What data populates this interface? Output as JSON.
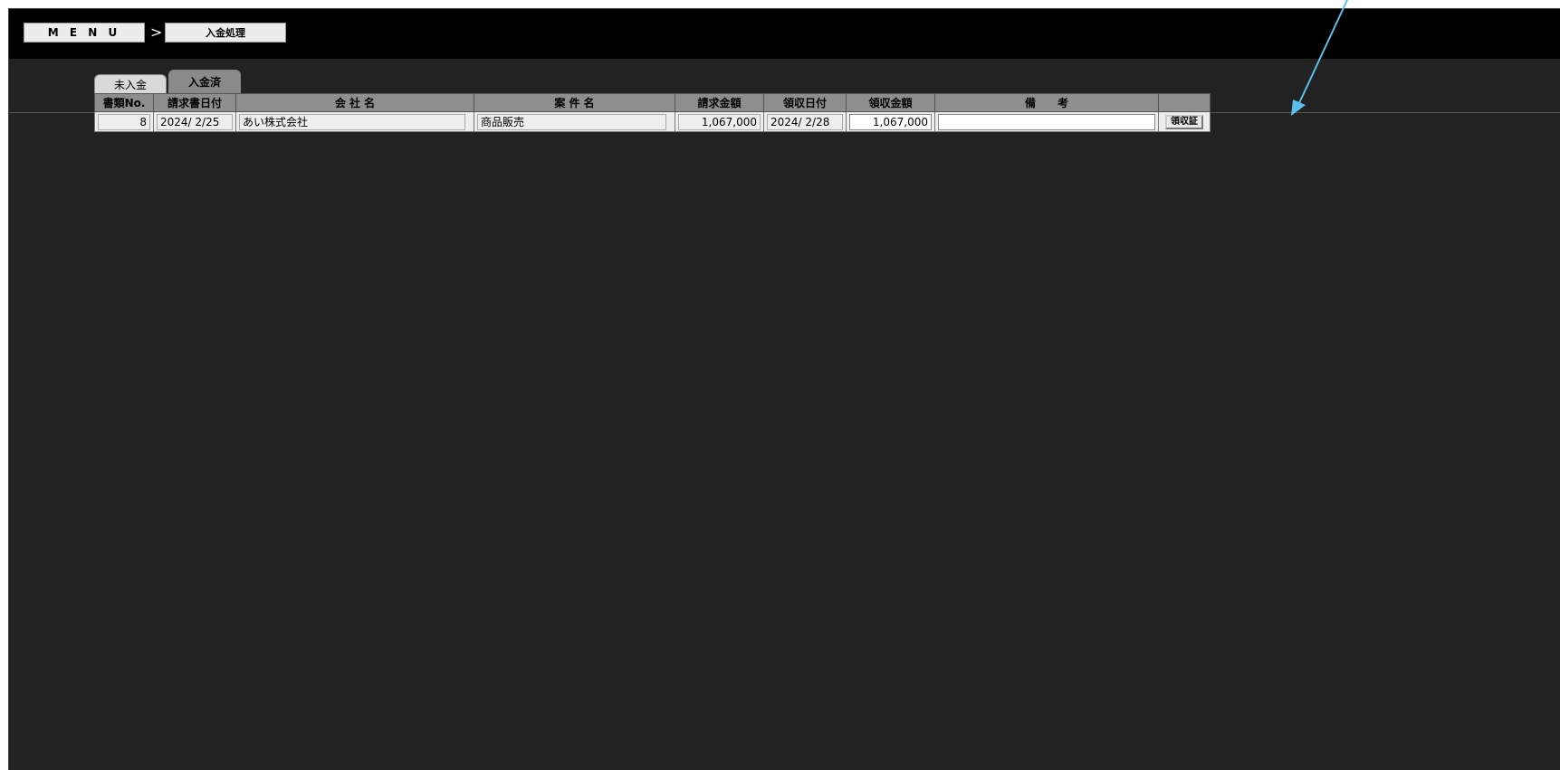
{
  "breadcrumb": {
    "menu_label": "M E N U",
    "separator": ">",
    "current_label": "入金処理"
  },
  "tabs": [
    {
      "label": "未入金",
      "active": false
    },
    {
      "label": "入金済",
      "active": true
    }
  ],
  "table": {
    "headers": [
      "書類No.",
      "請求書日付",
      "会 社 名",
      "案 件 名",
      "請求金額",
      "領収日付",
      "領収金額",
      "備　　考",
      ""
    ],
    "rows": [
      {
        "doc_no": "8",
        "invoice_date": "2024/ 2/25",
        "company": "あい株式会社",
        "project": "商品販売",
        "invoice_amount": "1,067,000",
        "receipt_date": "2024/ 2/28",
        "receipt_amount": "1,067,000",
        "remarks": "",
        "receipt_button": "領収証"
      }
    ]
  },
  "colors": {
    "background": "#222222",
    "topbar": "#000000",
    "header_cell": "#8e8e8e",
    "annotation_arrow": "#5bc0eb"
  },
  "icons": {
    "annotation": "arrow-pointer-icon"
  }
}
